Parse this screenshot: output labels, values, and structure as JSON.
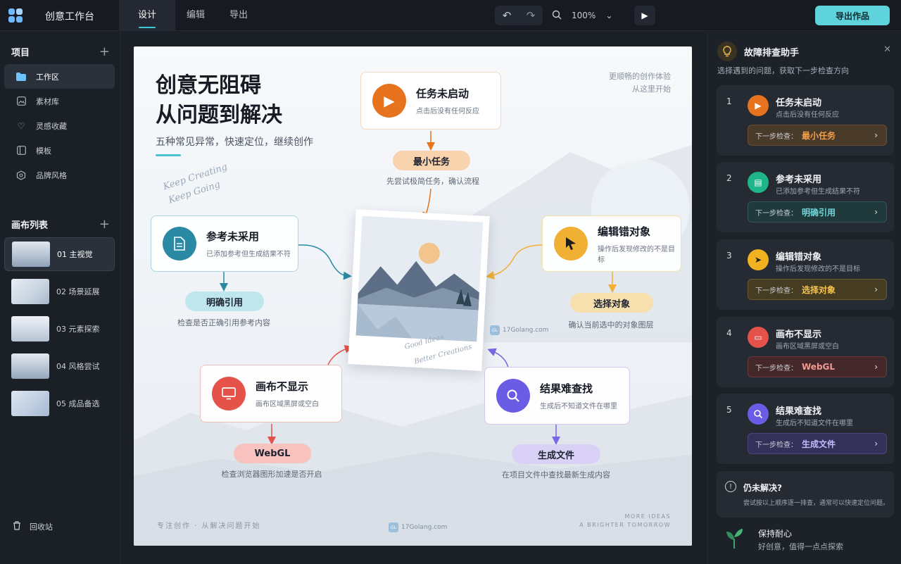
{
  "app": {
    "title": "创意工作台"
  },
  "tabs": [
    "设计",
    "编辑",
    "导出"
  ],
  "toolbar": {
    "zoom": "100%",
    "export_label": "导出作品"
  },
  "sidebar": {
    "projects_title": "项目",
    "nav": [
      {
        "label": "工作区",
        "icon": "folder-icon"
      },
      {
        "label": "素材库",
        "icon": "image-icon"
      },
      {
        "label": "灵感收藏",
        "icon": "heart-icon"
      },
      {
        "label": "模板",
        "icon": "template-icon"
      },
      {
        "label": "品牌风格",
        "icon": "palette-icon"
      }
    ],
    "canvas_title": "画布列表",
    "canvases": [
      {
        "label": "01  主视觉"
      },
      {
        "label": "02  场景延展"
      },
      {
        "label": "03  元素探索"
      },
      {
        "label": "04  风格尝试"
      },
      {
        "label": "05  成品备选"
      }
    ],
    "trash": "回收站"
  },
  "artboard": {
    "title_line1": "创意无阻碍",
    "title_line2": "从问题到解决",
    "subtitle": "五种常见异常，快速定位，继续创作",
    "script_1": "Keep Creating",
    "script_2": "Keep Going",
    "top_right_1": "更顺畅的创作体验",
    "top_right_2": "从这里开始",
    "photo_script_1": "Good Ideas",
    "photo_script_2": "Better Creations",
    "cards": [
      {
        "title": "任务未启动",
        "desc": "点击后没有任何反应",
        "pill": "最小任务",
        "hint": "先尝试极简任务，确认流程"
      },
      {
        "title": "参考未采用",
        "desc": "已添加参考但生成结果不符",
        "pill": "明确引用",
        "hint": "检查是否正确引用参考内容"
      },
      {
        "title": "编辑错对象",
        "desc": "操作后发现修改的不是目标",
        "pill": "选择对象",
        "hint": "确认当前选中的对象图层"
      },
      {
        "title": "画布不显示",
        "desc": "画布区域黑屏或空白",
        "pill": "WebGL",
        "hint": "检查浏览器图形加速是否开启"
      },
      {
        "title": "结果难查找",
        "desc": "生成后不知道文件在哪里",
        "pill": "生成文件",
        "hint": "在项目文件中查找最新生成内容"
      }
    ],
    "footer_left": "专注创作 · 从解决问题开始",
    "footer_right_1": "MORE IDEAS",
    "footer_right_2": "A BRIGHTER TOMORROW",
    "watermark": "17Golang.com"
  },
  "panel": {
    "title": "故障排查助手",
    "subtitle": "选择遇到的问题，获取下一步检查方向",
    "next_prefix": "下一步检查：",
    "items": [
      {
        "num": "1",
        "title": "任务未启动",
        "desc": "点击后没有任何反应",
        "next": "最小任务",
        "color": "#e8731f"
      },
      {
        "num": "2",
        "title": "参考未采用",
        "desc": "已添加参考但生成结果不符",
        "next": "明确引用",
        "color": "#1fb58a"
      },
      {
        "num": "3",
        "title": "编辑错对象",
        "desc": "操作后发现修改的不是目标",
        "next": "选择对象",
        "color": "#f0b21f"
      },
      {
        "num": "4",
        "title": "画布不显示",
        "desc": "画布区域黑屏或空白",
        "next": "WebGL",
        "color": "#e5524a"
      },
      {
        "num": "5",
        "title": "结果难查找",
        "desc": "生成后不知道文件在哪里",
        "next": "生成文件",
        "color": "#6b5ce6"
      }
    ],
    "unsolved_title": "仍未解决?",
    "unsolved_desc": "尝试按以上顺序逐一排查，通常可以快速定位问题。",
    "patience_title": "保持耐心",
    "patience_desc": "好创意，值得一点点探索"
  }
}
